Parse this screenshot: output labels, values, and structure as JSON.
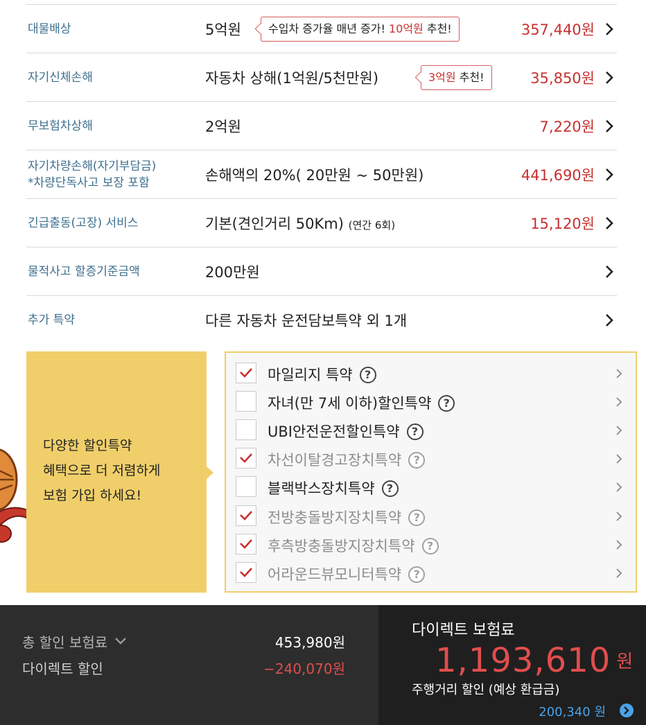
{
  "coverages": [
    {
      "name": "대물배상",
      "detail": "5억원",
      "detail_small": "",
      "tip_prefix": "수입차 증가율 매년 증가! ",
      "tip_highlight": "10억원",
      "tip_suffix": " 추천!",
      "price": "357,440원"
    },
    {
      "name": "자기신체손해",
      "detail": "자동차 상해(1억원/5천만원)",
      "detail_small": "",
      "tip_prefix": "",
      "tip_highlight": "3억원",
      "tip_suffix": " 추천!",
      "price": "35,850원"
    },
    {
      "name": "무보험차상해",
      "detail": "2억원",
      "detail_small": "",
      "price": "7,220원"
    },
    {
      "name": "자기차량손해(자기부담금)",
      "name_line2": "*차량단독사고 보장 포함",
      "detail": "손해액의 20%( 20만원 ~ 50만원)",
      "detail_small": "",
      "price": "441,690원"
    },
    {
      "name": "긴급출동(고장) 서비스",
      "detail": "기본(견인거리 50Km)",
      "detail_small": "(연간 6회)",
      "price": "15,120원"
    },
    {
      "name": "물적사고 할증기준금액",
      "detail": "200만원",
      "detail_small": "",
      "price": ""
    },
    {
      "name": "추가 특약",
      "detail": "다른 자동차 운전담보특약 외 1개",
      "detail_small": "",
      "price": ""
    }
  ],
  "promo": {
    "line1": "다양한 할인특약",
    "line2": "혜택으로 더 저렴하게",
    "line3": "보험 가입 하세요!"
  },
  "discounts": [
    {
      "label": "마일리지 특약",
      "checked": true,
      "muted": false
    },
    {
      "label": "자녀(만 7세 이하)할인특약",
      "checked": false,
      "muted": false
    },
    {
      "label": "UBI안전운전할인특약",
      "checked": false,
      "muted": false
    },
    {
      "label": "차선이탈경고장치특약",
      "checked": true,
      "muted": true
    },
    {
      "label": "블랙박스장치특약",
      "checked": false,
      "muted": false
    },
    {
      "label": "전방충돌방지장치특약",
      "checked": true,
      "muted": true
    },
    {
      "label": "후측방충돌방지장치특약",
      "checked": true,
      "muted": true
    },
    {
      "label": "어라운드뷰모니터특약",
      "checked": true,
      "muted": true
    }
  ],
  "help_glyph": "?",
  "footer": {
    "total_discount_label": "총 할인 보험료",
    "total_discount_value": "453,980원",
    "direct_discount_label": "다이렉트 할인",
    "direct_discount_value": "−240,070원",
    "premium_title": "다이렉트 보험료",
    "premium_amount": "1,193,610",
    "premium_unit": "원",
    "mileage_label": "주행거리 할인 (예상 환급금)",
    "mileage_value": "200,340 원"
  },
  "colors": {
    "accent_red": "#c6302f",
    "label_blue": "#3e6f8e",
    "promo_yellow": "#f0cf6a",
    "footer_dark": "#2d2d2d",
    "refund_blue": "#4aa3e8"
  }
}
